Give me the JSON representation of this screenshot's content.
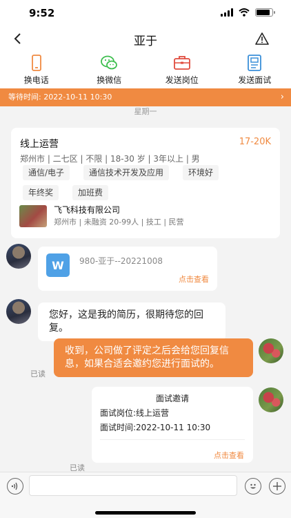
{
  "status": {
    "time": "9:52"
  },
  "nav": {
    "title": "亚于",
    "back_icon": "chevron-left-icon",
    "report_icon": "warning-triangle-icon"
  },
  "actions": [
    {
      "label": "换电话",
      "icon": "phone-icon",
      "color": "#f08a41"
    },
    {
      "label": "换微信",
      "icon": "wechat-icon",
      "color": "#3dbf4e"
    },
    {
      "label": "发送岗位",
      "icon": "briefcase-icon",
      "color": "#e04a3c"
    },
    {
      "label": "发送面试",
      "icon": "document-icon",
      "color": "#3a8fd9"
    }
  ],
  "wait": {
    "text": "等待时间: 2022-10-11 10:30"
  },
  "weekday": "星期一",
  "job": {
    "title": "线上运营",
    "salary": "17-20K",
    "meta": "郑州市 | 二七区 | 不限 | 18-30 岁 | 3年以上 | 男",
    "tags": [
      "通信/电子",
      "通信技术开发及应用",
      "环境好",
      "年终奖",
      "加班费"
    ],
    "company_name": "飞飞科技有限公司",
    "company_meta": "郑州市 | 未融资 20-99人 | 技工 | 民营"
  },
  "file_message": {
    "icon_letter": "W",
    "name": "980-亚于--20221008",
    "view": "点击查看"
  },
  "messages": {
    "resume_text": "您好，这是我的简历，很期待您的回复。",
    "reply_text": "收到，公司做了评定之后会给您回复信息，如果合适会邀约您进行面试的。",
    "read_label_1": "已读",
    "read_label_2": "已读"
  },
  "interview": {
    "title": "面试邀请",
    "position": "面试岗位:线上运营",
    "time": "面试时间:2022-10-11 10:30",
    "view": "点击查看"
  },
  "input": {
    "placeholder": "",
    "voice_icon": "voice-icon",
    "emoji_icon": "emoji-icon",
    "add_icon": "plus-icon"
  }
}
